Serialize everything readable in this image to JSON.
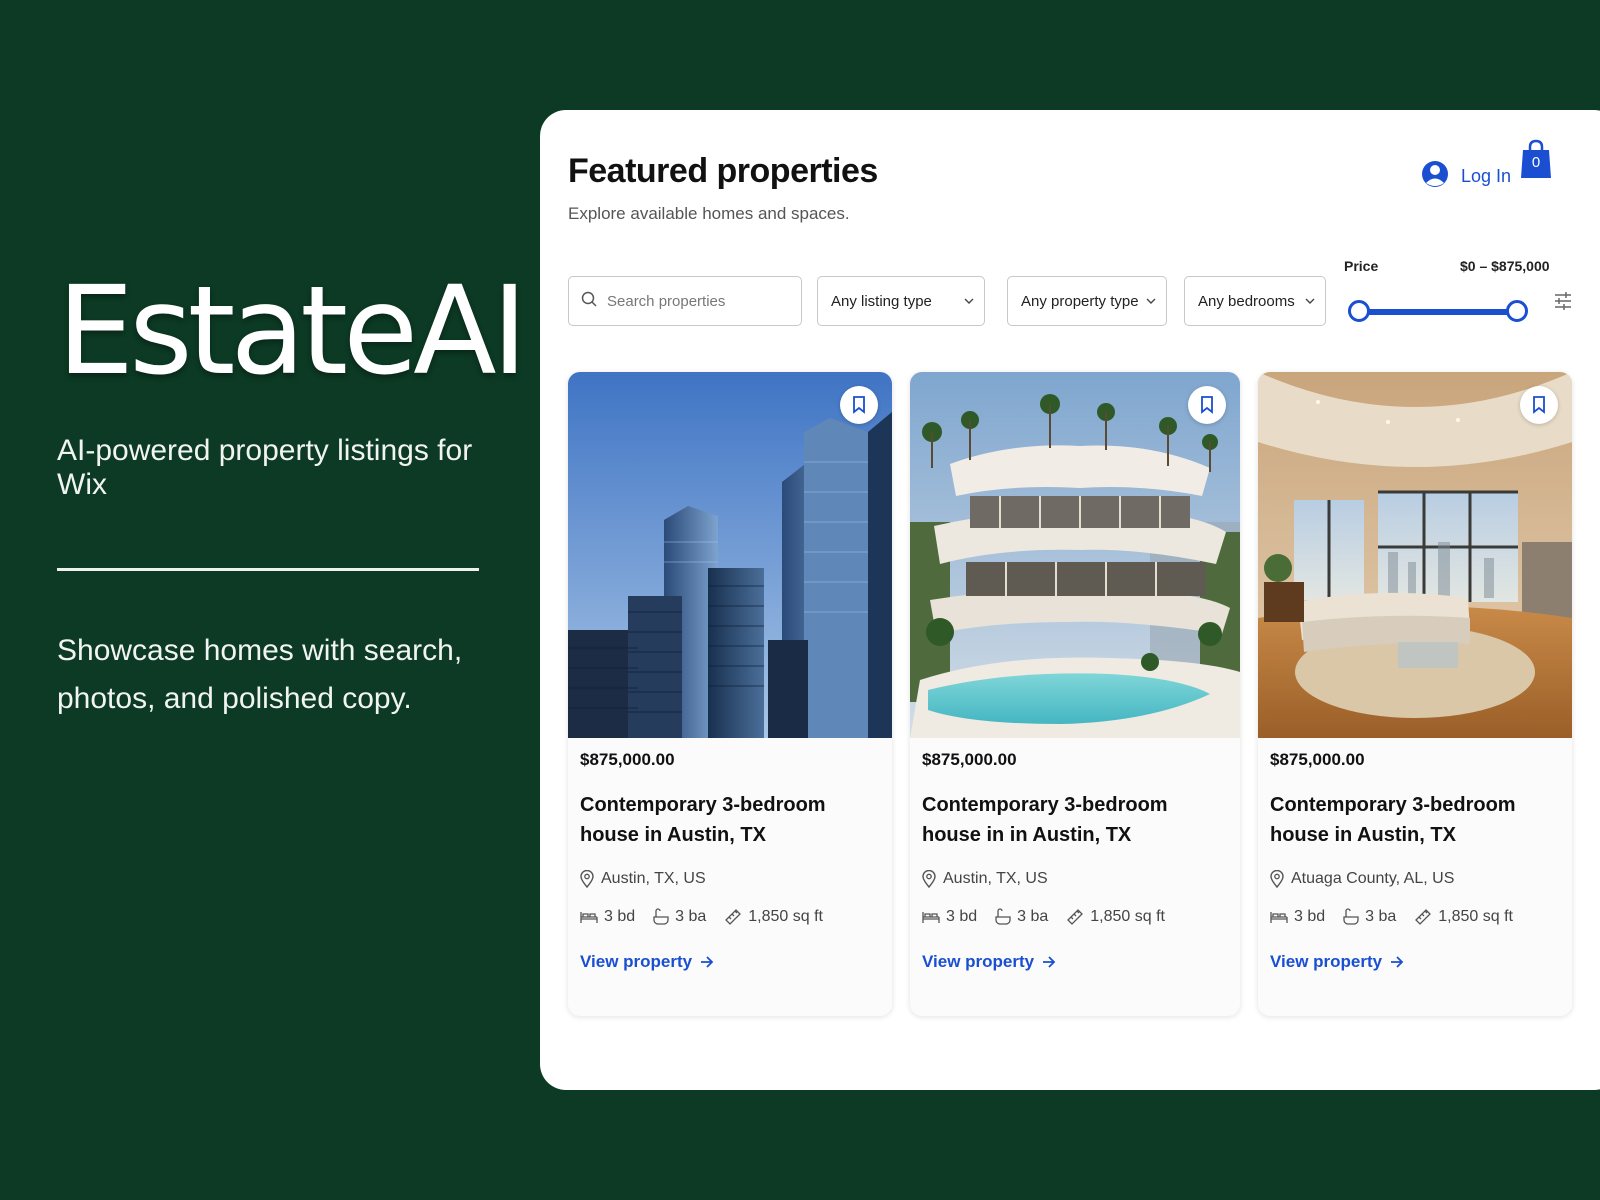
{
  "hero": {
    "title": "EstateAI",
    "tagline": "AI-powered property listings for Wix",
    "description": "Showcase homes with search, photos, and polished copy."
  },
  "panel": {
    "title": "Featured properties",
    "subtitle": "Explore available homes and spaces.",
    "login_label": "Log In",
    "cart_count": "0"
  },
  "filters": {
    "search_placeholder": "Search properties",
    "listing_type": "Any listing type",
    "property_type": "Any property type",
    "bedrooms": "Any bedrooms",
    "price_label": "Price",
    "price_range": "$0 – $875,000"
  },
  "listings": [
    {
      "price": "$875,000.00",
      "title": "Contemporary 3-bedroom house in Austin, TX",
      "location": "Austin, TX, US",
      "beds": "3 bd",
      "baths": "3 ba",
      "area": "1,850 sq ft",
      "cta": "View property"
    },
    {
      "price": "$875,000.00",
      "title": "Contemporary 3-bedroom house in in Austin, TX",
      "location": "Austin, TX, US",
      "beds": "3 bd",
      "baths": "3 ba",
      "area": "1,850 sq ft",
      "cta": "View property"
    },
    {
      "price": "$875,000.00",
      "title": "Contemporary 3-bedroom house in Austin, TX",
      "location": "Atuaga County, AL, US",
      "beds": "3 bd",
      "baths": "3 ba",
      "area": "1,850 sq ft",
      "cta": "View property"
    }
  ],
  "colors": {
    "background": "#0c3a24",
    "accent": "#1a4fd1"
  },
  "icons": [
    "search-icon",
    "user-icon",
    "shopping-bag-icon",
    "chevron-down-icon",
    "sliders-icon",
    "bookmark-icon",
    "location-pin-icon",
    "bed-icon",
    "bath-icon",
    "ruler-icon",
    "arrow-right-icon"
  ]
}
